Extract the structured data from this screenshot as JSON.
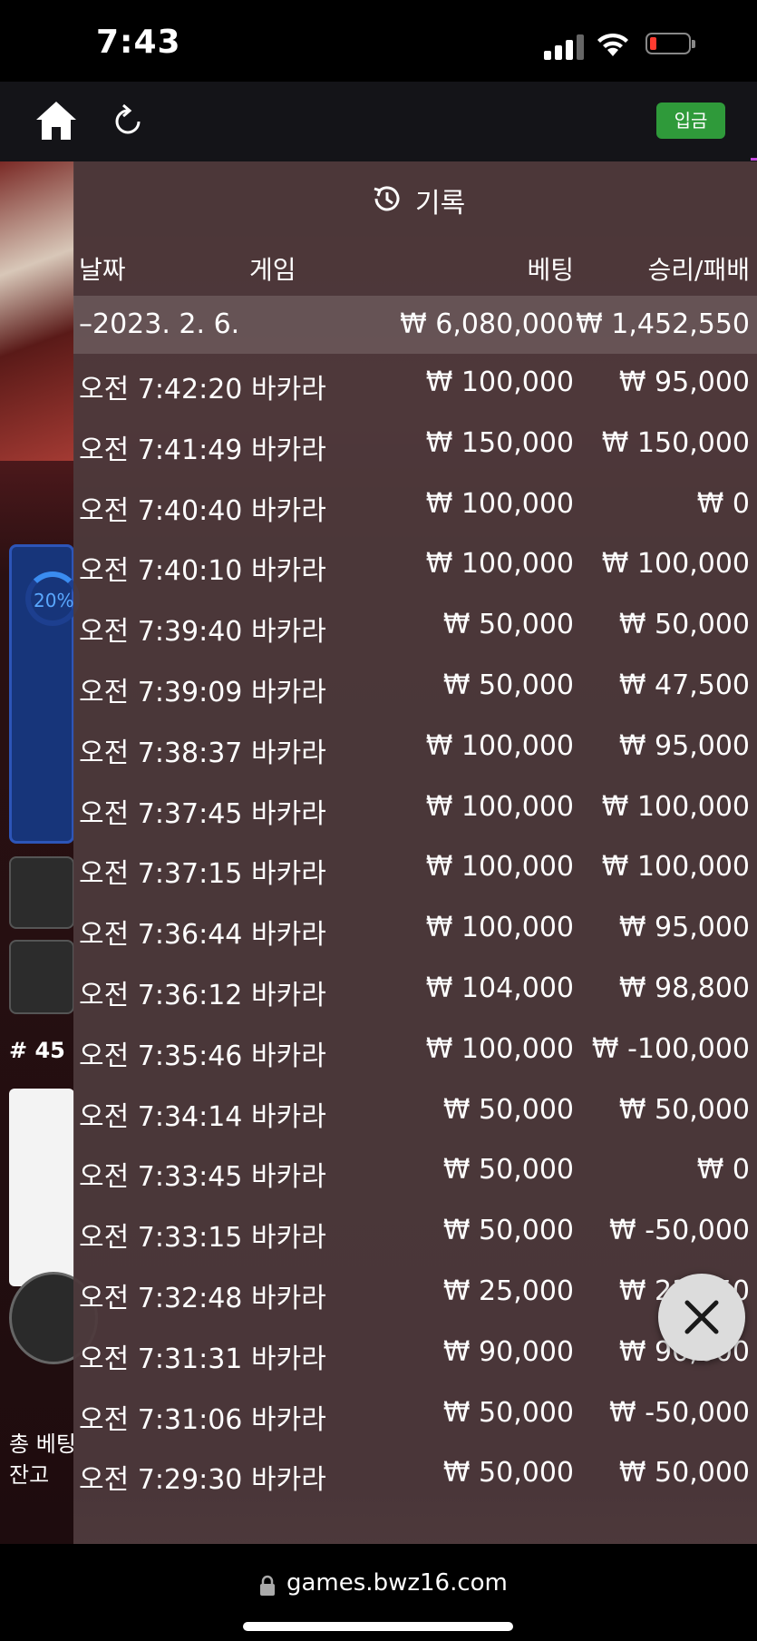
{
  "status_bar": {
    "time": "7:43"
  },
  "toolbar": {
    "deposit_label": "입금"
  },
  "background": {
    "progress_label": "20%",
    "round_label": "# 45",
    "total_bet_label": "총 베팅",
    "balance_label": "잔고"
  },
  "history": {
    "title": "기록",
    "columns": {
      "date": "날짜",
      "game": "게임",
      "bet": "베팅",
      "win_loss": "승리/패배"
    },
    "summary": {
      "date": "–2023. 2. 6.",
      "bet": "₩ 6,080,000",
      "win_loss": "₩ 1,452,550"
    },
    "rows": [
      {
        "time": "오전 7:42:20",
        "game": "바카라",
        "bet": "₩ 100,000",
        "win_loss": "₩ 95,000"
      },
      {
        "time": "오전 7:41:49",
        "game": "바카라",
        "bet": "₩ 150,000",
        "win_loss": "₩ 150,000"
      },
      {
        "time": "오전 7:40:40",
        "game": "바카라",
        "bet": "₩ 100,000",
        "win_loss": "₩ 0"
      },
      {
        "time": "오전 7:40:10",
        "game": "바카라",
        "bet": "₩ 100,000",
        "win_loss": "₩ 100,000"
      },
      {
        "time": "오전 7:39:40",
        "game": "바카라",
        "bet": "₩ 50,000",
        "win_loss": "₩ 50,000"
      },
      {
        "time": "오전 7:39:09",
        "game": "바카라",
        "bet": "₩ 50,000",
        "win_loss": "₩ 47,500"
      },
      {
        "time": "오전 7:38:37",
        "game": "바카라",
        "bet": "₩ 100,000",
        "win_loss": "₩ 95,000"
      },
      {
        "time": "오전 7:37:45",
        "game": "바카라",
        "bet": "₩ 100,000",
        "win_loss": "₩ 100,000"
      },
      {
        "time": "오전 7:37:15",
        "game": "바카라",
        "bet": "₩ 100,000",
        "win_loss": "₩ 100,000"
      },
      {
        "time": "오전 7:36:44",
        "game": "바카라",
        "bet": "₩ 100,000",
        "win_loss": "₩ 95,000"
      },
      {
        "time": "오전 7:36:12",
        "game": "바카라",
        "bet": "₩ 104,000",
        "win_loss": "₩ 98,800"
      },
      {
        "time": "오전 7:35:46",
        "game": "바카라",
        "bet": "₩ 100,000",
        "win_loss": "₩ -100,000"
      },
      {
        "time": "오전 7:34:14",
        "game": "바카라",
        "bet": "₩ 50,000",
        "win_loss": "₩ 50,000"
      },
      {
        "time": "오전 7:33:45",
        "game": "바카라",
        "bet": "₩ 50,000",
        "win_loss": "₩ 0"
      },
      {
        "time": "오전 7:33:15",
        "game": "바카라",
        "bet": "₩ 50,000",
        "win_loss": "₩ -50,000"
      },
      {
        "time": "오전 7:32:48",
        "game": "바카라",
        "bet": "₩ 25,000",
        "win_loss": "₩ 23,750"
      },
      {
        "time": "오전 7:31:31",
        "game": "바카라",
        "bet": "₩ 90,000",
        "win_loss": "₩ 90,000"
      },
      {
        "time": "오전 7:31:06",
        "game": "바카라",
        "bet": "₩ 50,000",
        "win_loss": "₩ -50,000"
      },
      {
        "time": "오전 7:29:30",
        "game": "바카라",
        "bet": "₩ 50,000",
        "win_loss": "₩ 50,000"
      }
    ]
  },
  "browser": {
    "url": "games.bwz16.com"
  },
  "colors": {
    "deposit_green": "#2f9a3a",
    "panel_bg": "#4e3a3c",
    "battery_red": "#ff3b30"
  }
}
